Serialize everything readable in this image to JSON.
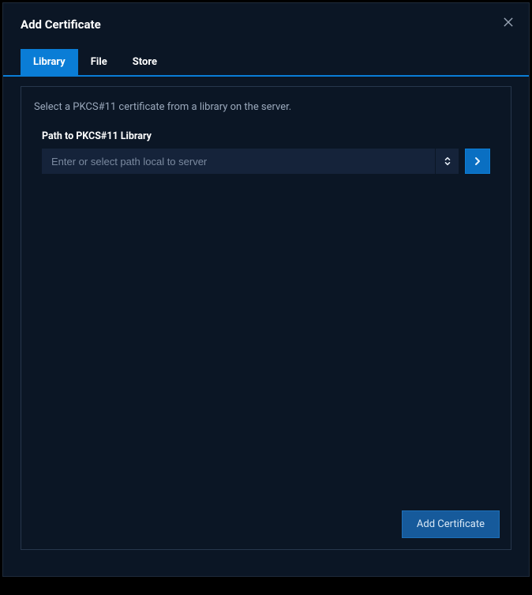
{
  "dialog": {
    "title": "Add Certificate",
    "description": "Select a PKCS#11 certificate from a library on the server."
  },
  "tabs": {
    "library": "Library",
    "file": "File",
    "store": "Store"
  },
  "field": {
    "label": "Path to PKCS#11 Library",
    "placeholder": "Enter or select path local to server",
    "value": ""
  },
  "buttons": {
    "submit": "Add Certificate"
  }
}
